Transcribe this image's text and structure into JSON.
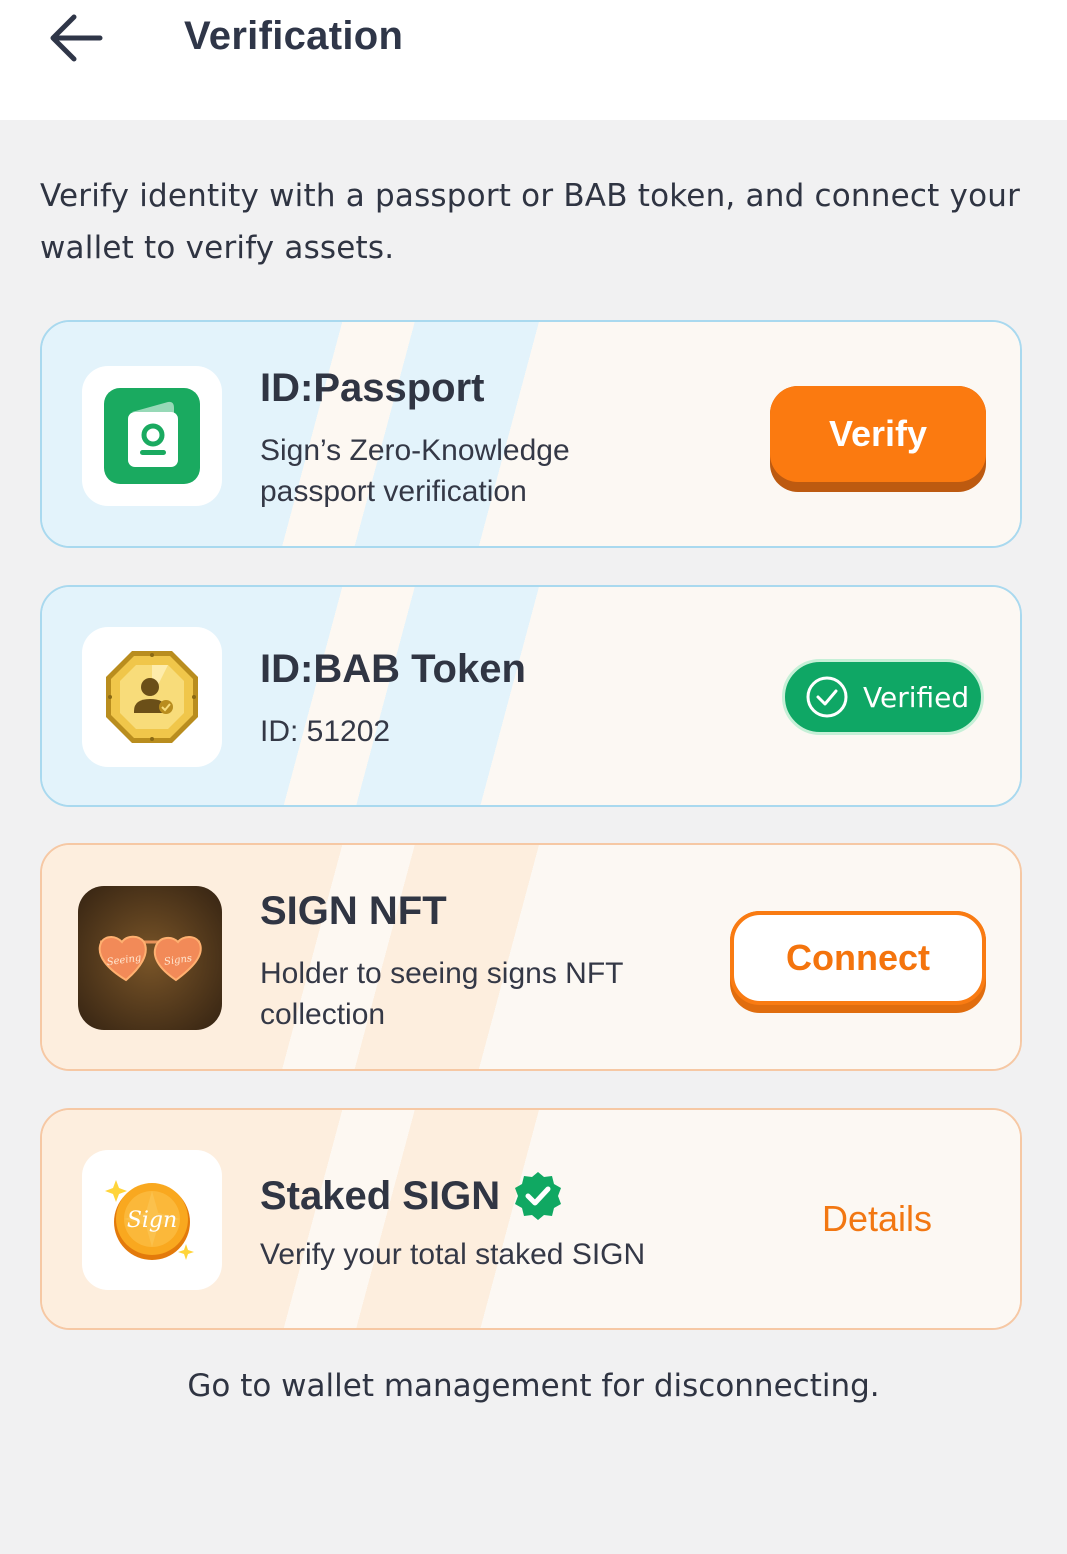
{
  "header": {
    "title": "Verification",
    "back_icon": "arrow-left-icon"
  },
  "intro": "Verify identity with a passport or BAB token, and connect your wallet to verify assets.",
  "cards": [
    {
      "title": "ID:Passport",
      "description": "Sign’s Zero-Knowledge passport verification",
      "icon": "passport-icon",
      "action_label": "Verify",
      "theme": "blue"
    },
    {
      "title": "ID:BAB Token",
      "description": "ID: 51202",
      "icon": "bab-token-badge-icon",
      "action_label": "Verified",
      "theme": "blue"
    },
    {
      "title": "SIGN NFT",
      "description": "Holder to seeing signs NFT collection",
      "icon": "heart-sunglasses-nft-image",
      "nft_glasses_text": [
        "Seeing",
        "Signs"
      ],
      "action_label": "Connect",
      "theme": "orange"
    },
    {
      "title": "Staked SIGN",
      "description": "Verify your total staked SIGN",
      "icon": "sign-coin-icon",
      "coin_text": "Sign",
      "title_badge_icon": "verified-seal-icon",
      "action_label": "Details",
      "theme": "orange"
    }
  ],
  "footer_note": "Go to wallet management for disconnecting.",
  "colors": {
    "accent_orange": "#fb7a10",
    "verified_green": "#0fa765",
    "card_blue_border": "#a9d9ef",
    "card_orange_border": "#f6c8a4",
    "page_background": "#f1f1f2"
  }
}
